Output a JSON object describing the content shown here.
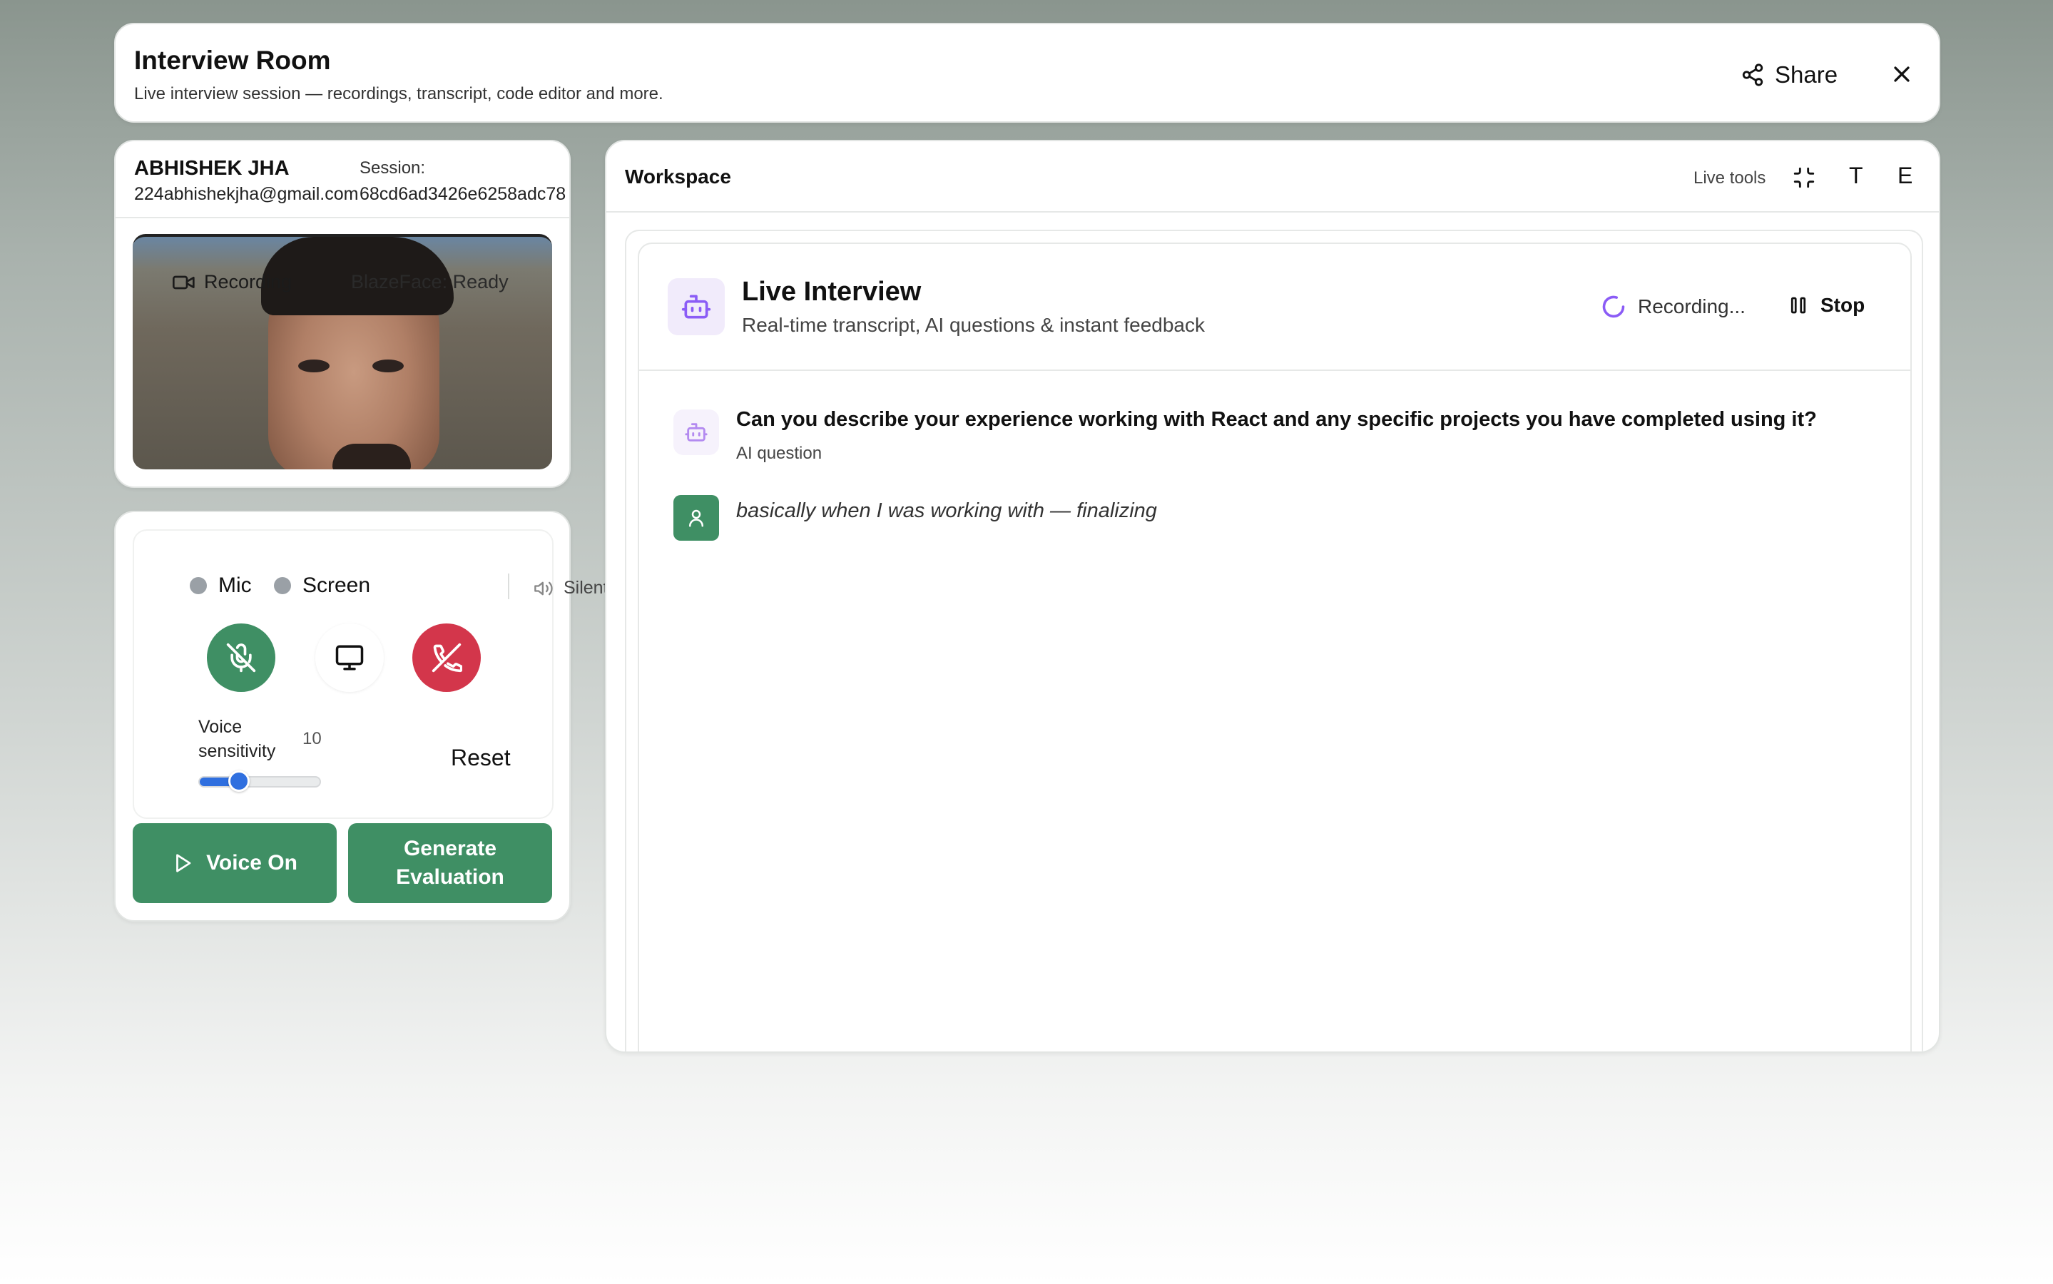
{
  "header": {
    "title": "Interview Room",
    "subtitle": "Live interview session — recordings, transcript, code editor and more.",
    "share_label": "Share"
  },
  "profile": {
    "name": "ABHISHEK JHA",
    "email": "224abhishekjha@gmail.com",
    "session_label": "Session:",
    "session_id": "68cd6ad3426e6258adc78",
    "video_overlay": {
      "recording_label": "Recording",
      "face_status": "BlazeFace: Ready"
    }
  },
  "controls": {
    "mic_label": "Mic",
    "screen_label": "Screen",
    "silent_label": "Silent",
    "status_dot_color": "#9aa0a6",
    "voice_sensitivity_label": "Voice sensitivity",
    "voice_sensitivity_value": "10",
    "slider_fraction": 0.33,
    "reset_label": "Reset",
    "voice_on_label": "Voice On",
    "generate_eval_label": "Generate Evaluation",
    "mic_button_color": "#3f8f64",
    "end_call_color": "#d3364b",
    "accent_green": "#3f8f64"
  },
  "workspace": {
    "title": "Workspace",
    "live_tools_label": "Live tools",
    "tool_t": "T",
    "tool_e": "E",
    "live_interview": {
      "title": "Live Interview",
      "subtitle": "Real-time transcript, AI questions & instant feedback",
      "recording_status": "Recording...",
      "stop_label": "Stop"
    },
    "messages": [
      {
        "role": "ai",
        "text": "Can you describe your experience working with React and any specific projects you have completed using it?",
        "meta": "AI question"
      },
      {
        "role": "user",
        "text": "basically when I was working with — finalizing"
      }
    ],
    "robot_accent": "#8b5cf6"
  }
}
